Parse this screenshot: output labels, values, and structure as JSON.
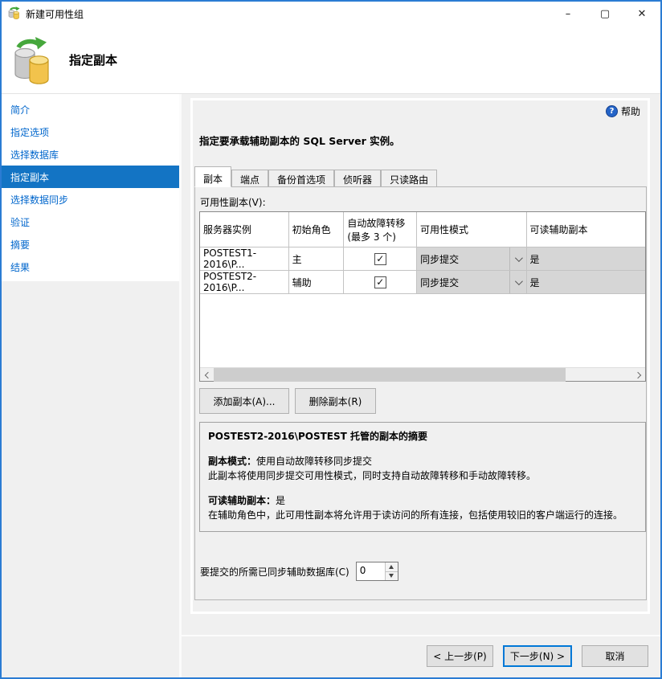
{
  "window": {
    "title": "新建可用性组",
    "controls": {
      "minimize": "–",
      "maximize": "▢",
      "close": "✕"
    }
  },
  "header": {
    "title": "指定副本"
  },
  "sidebar": {
    "items": [
      {
        "label": "简介"
      },
      {
        "label": "指定选项"
      },
      {
        "label": "选择数据库"
      },
      {
        "label": "指定副本"
      },
      {
        "label": "选择数据同步"
      },
      {
        "label": "验证"
      },
      {
        "label": "摘要"
      },
      {
        "label": "结果"
      }
    ]
  },
  "main": {
    "help": {
      "icon": "?",
      "label": "帮助"
    },
    "instruction": "指定要承载辅助副本的 SQL Server 实例。",
    "tabs": [
      {
        "label": "副本"
      },
      {
        "label": "端点"
      },
      {
        "label": "备份首选项"
      },
      {
        "label": "侦听器"
      },
      {
        "label": "只读路由"
      }
    ],
    "replicas_label": "可用性副本(V):",
    "table": {
      "columns": [
        "服务器实例",
        "初始角色",
        "自动故障转移(最多 3 个)",
        "可用性模式",
        "可读辅助副本"
      ],
      "check_glyph": "✓",
      "rows": [
        {
          "instance": "POSTEST1-2016\\P...",
          "role": "主",
          "mode": "同步提交",
          "readable": "是"
        },
        {
          "instance": "POSTEST2-2016\\P...",
          "role": "辅助",
          "mode": "同步提交",
          "readable": "是"
        }
      ]
    },
    "buttons": {
      "add": "添加副本(A)...",
      "remove": "删除副本(R)"
    },
    "summary": {
      "title": "POSTEST2-2016\\POSTEST 托管的副本的摘要",
      "mode_label": "副本模式：",
      "mode_value": "使用自动故障转移同步提交",
      "mode_desc": "此副本将使用同步提交可用性模式，同时支持自动故障转移和手动故障转移。",
      "readable_label": "可读辅助副本：",
      "readable_value": "是",
      "readable_desc": "在辅助角色中，此可用性副本将允许用于读访问的所有连接，包括使用较旧的客户端运行的连接。"
    },
    "commit": {
      "label": "要提交的所需已同步辅助数据库(C)",
      "value": "0"
    }
  },
  "footer": {
    "back": "< 上一步(P)",
    "next": "下一步(N) >",
    "cancel": "取消"
  },
  "colors": {
    "accent": "#0078d7",
    "nav_selected": "#1374c4",
    "link": "#0066cc"
  }
}
